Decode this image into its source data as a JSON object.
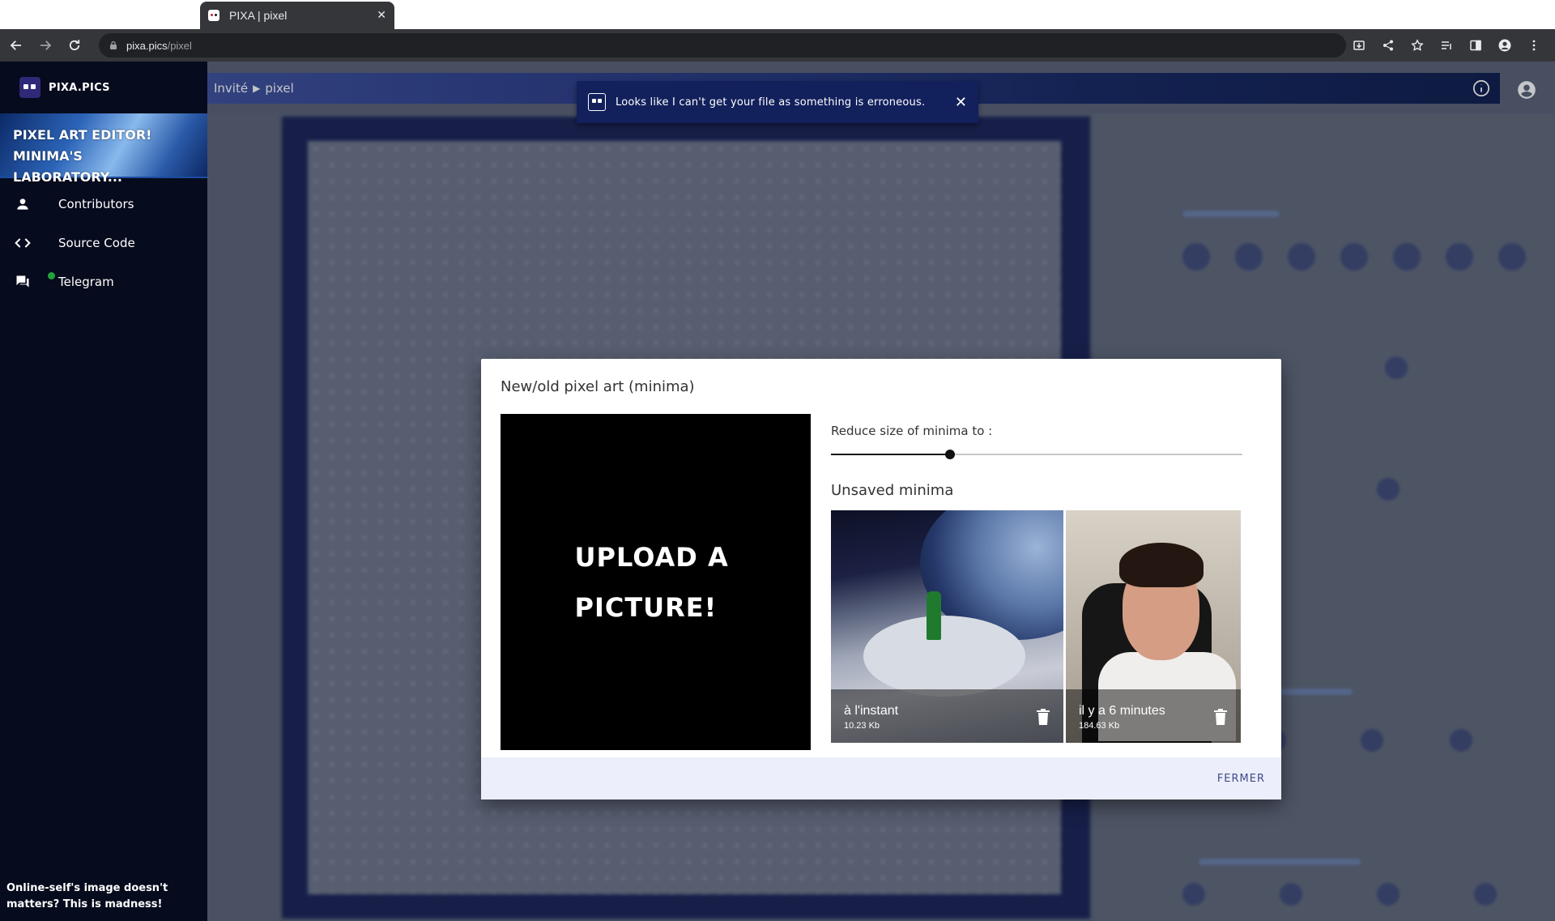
{
  "browser": {
    "tab_title": "PIXA | pixel",
    "url_host": "pixa.pics",
    "url_path": "/pixel"
  },
  "sidebar": {
    "brand": "PIXA.PICS",
    "banner_line1": "PIXEL ART EDITOR!",
    "banner_line2": "MINIMA'S LABORATORY...",
    "items": [
      {
        "label": "Contributors",
        "icon": "person-icon"
      },
      {
        "label": "Source Code",
        "icon": "code-icon"
      },
      {
        "label": "Telegram",
        "icon": "chat-icon"
      }
    ],
    "footer": "Online-self's image doesn't matters? This is madness!"
  },
  "appbar": {
    "crumb_user": "Invité",
    "crumb_sep": "▶",
    "crumb_page": "pixel"
  },
  "toast": {
    "message": "Looks like I can't get your file as something is erroneous.",
    "close": "✕"
  },
  "dialog": {
    "title": "New/old pixel art (minima)",
    "upload_text_line1": "UPLOAD A",
    "upload_text_line2": "PICTURE!",
    "reduce_label": "Reduce size of minima to :",
    "slider_fraction": 0.29,
    "unsaved_title": "Unsaved minima",
    "items": [
      {
        "when": "à l'instant",
        "size": "10.23 Kb"
      },
      {
        "when": "il y a 6 minutes",
        "size": "184.63 Kb"
      }
    ],
    "close_button": "FERMER"
  }
}
